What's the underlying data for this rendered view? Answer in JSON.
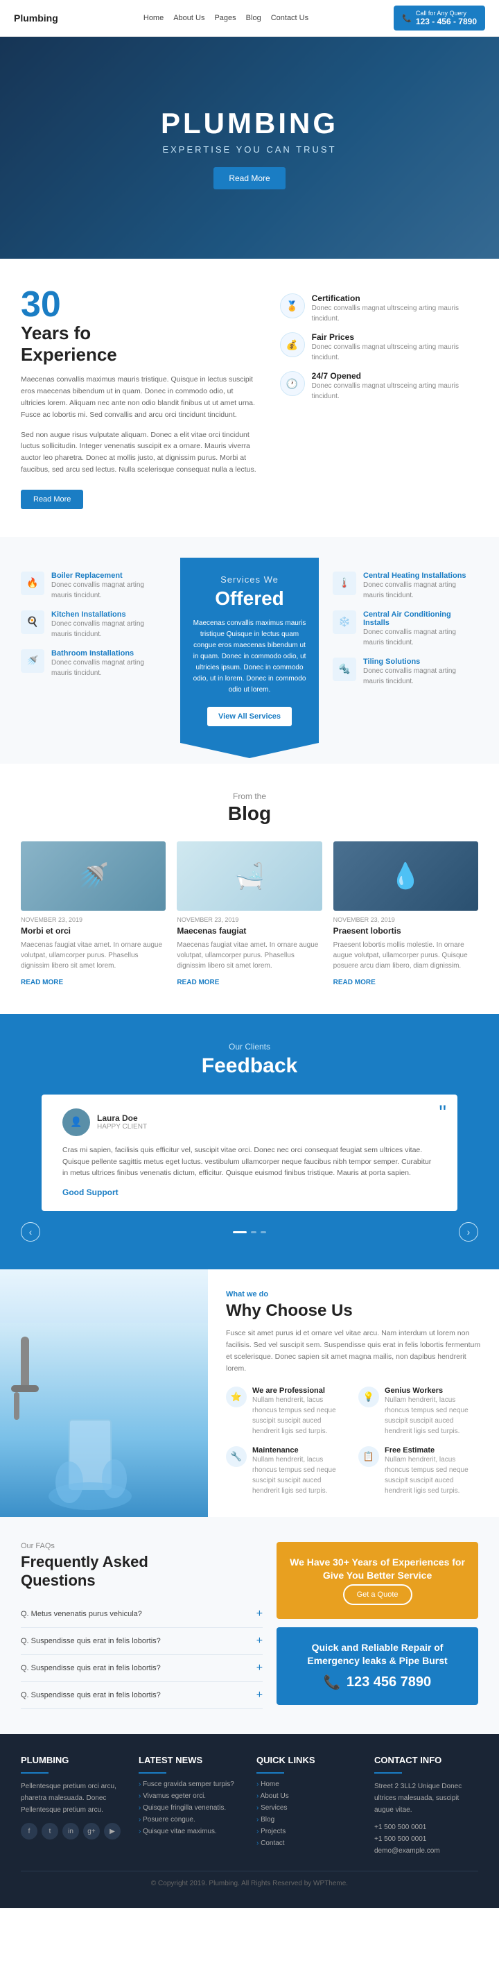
{
  "nav": {
    "logo": "Plumbing",
    "links": [
      "Home",
      "About Us",
      "Pages",
      "Blog",
      "Contact Us"
    ],
    "cta_label": "Call for Any Query",
    "phone": "123 - 456 - 7890"
  },
  "hero": {
    "title": "PLUMBING",
    "subtitle": "EXPERTISE YOU CAN TRUST",
    "btn": "Read More"
  },
  "experience": {
    "number": "30",
    "label_line1": "Years fo",
    "label_line2": "Experience",
    "text1": "Maecenas convallis maximus mauris tristique. Quisque in lectus suscipit eros maecenas bibendum ut in quam. Donec in commodo odio, ut ultricies lorem. Aliquam nec ante non odio blandit finibus ut ut amet urna. Fusce ac lobortis mi. Sed convallis and arcu orci tincidunt tincidunt.",
    "text2": "Sed non augue risus vulputate aliquam. Donec a elit vitae orci tincidunt luctus sollicitudin. Integer venenatis suscipit ex a ornare. Mauris viverra auctor leo pharetra. Donec at mollis justo, at dignissim purus. Morbi at faucibus, sed arcu sed lectus. Nulla scelerisque consequat nulla a lectus.",
    "btn": "Read More",
    "features": [
      {
        "icon": "🏅",
        "title": "Certification",
        "text": "Donec convallis magnat ultrsceing arting mauris tincidunt."
      },
      {
        "icon": "💰",
        "title": "Fair Prices",
        "text": "Donec convallis magnat ultrsceing arting mauris tincidunt."
      },
      {
        "icon": "🕐",
        "title": "24/7 Opened",
        "text": "Donec convallis magnat ultrsceing arting mauris tincidunt."
      }
    ]
  },
  "services": {
    "sub": "Services We",
    "title": "Offered",
    "desc": "Maecenas convallis maximus mauris tristique Quisque in lectus quam congue eros maecenas bibendum ut in quam. Donec in commodo odio, ut ultricies ipsum. Donec in commodo odio, ut in lorem. Donec in commodo odio ut lorem.",
    "btn": "View All Services",
    "left_items": [
      {
        "icon": "🔧",
        "title": "Boiler Replacement",
        "text": "Donec convallis magnat arting mauris tincidunt."
      },
      {
        "icon": "🍳",
        "title": "Kitchen Installations",
        "text": "Donec convallis magnat arting mauris tincidunt."
      },
      {
        "icon": "🚿",
        "title": "Bathroom Installations",
        "text": "Donec convallis magnat arting mauris tincidunt."
      }
    ],
    "right_items": [
      {
        "icon": "🌡️",
        "title": "Central Heating Installations",
        "text": "Donec convallis magnat arting mauris tincidunt."
      },
      {
        "icon": "❄️",
        "title": "Central Air Conditioning Installs",
        "text": "Donec convallis magnat arting mauris tincidunt."
      },
      {
        "icon": "🔩",
        "title": "Tiling Solutions",
        "text": "Donec convallis magnat arting mauris tincidunt."
      }
    ]
  },
  "blog": {
    "sub": "From the",
    "title": "Blog",
    "posts": [
      {
        "date": "NOVEMBER 23, 2019",
        "title": "Morbi et orci",
        "text": "Maecenas faugiat vitae amet. In ornare augue volutpat, ullamcorper purus. Phasellus dignissim libero sit amet lorem.",
        "read": "READ MORE",
        "img_type": "faucet"
      },
      {
        "date": "NOVEMBER 23, 2019",
        "title": "Maecenas faugiat",
        "text": "Maecenas faugiat vitae amet. In ornare augue volutpat, ullamcorper purus. Phasellus dignissim libero sit amet lorem.",
        "read": "READ MORE",
        "img_type": "bath"
      },
      {
        "date": "NOVEMBER 23, 2019",
        "title": "Praesent lobortis",
        "text": "Praesent lobortis mollis molestie. In ornare augue volutpat, ullamcorper purus. Quisque posuere arcu diam libero, diam dignissim.",
        "read": "READ MORE",
        "img_type": "shower"
      }
    ]
  },
  "feedback": {
    "sub": "Our Clients",
    "title": "Feedback",
    "testimonials": [
      {
        "name": "Laura Doe",
        "role": "HAPPY CLIENT",
        "text": "Cras mi sapien, facilisis quis efficitur vel, suscipit vitae orci. Donec nec orci consequat feugiat sem ultrices vitae. Quisque pellente sagittis metus eget luctus. vestibulum ullamcorper neque faucibus nibh tempor semper. Curabitur in metus ultrices finibus venenatis dictum, efficitur. Quisque euismod finibus tristique. Mauris at porta sapien.",
        "rating": "Good Support"
      }
    ]
  },
  "why": {
    "sub": "What we do",
    "title": "Why Choose Us",
    "desc": "Fusce sit amet purus id et ornare vel vitae arcu. Nam interdum ut lorem non facilisis. Sed vel suscipit sem. Suspendisse quis erat in felis lobortis fermentum et scelerisque. Donec sapien sit amet magna mailis, non dapibus hendrerit lorem.",
    "features": [
      {
        "icon": "⭐",
        "title": "We are Professional",
        "text": "Nullam hendrerit, lacus rhoncus tempus sed neque suscipit suscipit auced hendrerit ligis sed turpis."
      },
      {
        "icon": "💡",
        "title": "Genius Workers",
        "text": "Nullam hendrerit, lacus rhoncus tempus sed neque suscipit suscipit auced hendrerit ligis sed turpis."
      },
      {
        "icon": "🔧",
        "title": "Maintenance",
        "text": "Nullam hendrerit, lacus rhoncus tempus sed neque suscipit suscipit auced hendrerit ligis sed turpis."
      },
      {
        "icon": "📋",
        "title": "Free Estimate",
        "text": "Nullam hendrerit, lacus rhoncus tempus sed neque suscipit suscipit auced hendrerit ligis sed turpis."
      }
    ]
  },
  "faq": {
    "sub": "Our FAQs",
    "title_line1": "Frequently Asked",
    "title_line2": "Questions",
    "items": [
      "Q. Metus venenatis purus vehicula?",
      "Q. Suspendisse quis erat in felis lobortis?",
      "Q. Suspendisse quis erat in felis lobortis?",
      "Q. Suspendisse quis erat in felis lobortis?"
    ]
  },
  "cta_gold": {
    "title": "We Have 30+ Years of Experiences for Give You Better Service",
    "btn": "Get a Quote"
  },
  "cta_blue": {
    "title": "Quick and Reliable Repair of Emergency leaks & Pipe Burst",
    "phone": "123 456 7890"
  },
  "footer": {
    "cols": [
      {
        "title": "PLUMBING",
        "text": "Pellentesque pretium orci arcu, pharetra malesuada. Donec Pellentesque pretium arcu.",
        "social": [
          "f",
          "t",
          "in",
          "g+",
          "yt"
        ]
      },
      {
        "title": "LATEST NEWS",
        "items": [
          "Fusce gravida semper turpis?",
          "Vivamus egeter orci.",
          "Quisque fringilla venenatis.",
          "Posuere congue.",
          "Quisque vitae maximus."
        ]
      },
      {
        "title": "QUICK LINKS",
        "items": [
          "Home",
          "About Us",
          "Services",
          "Blog",
          "Projects",
          "Contact"
        ]
      },
      {
        "title": "CONTACT INFO",
        "address": "Street 2 3LL2 Unique\nDonec ultrices malesuada, suscipit augue vitae.",
        "phone1": "+1 500 500 0001",
        "phone2": "+1 500 500 0001",
        "email": "demo@example.com"
      }
    ],
    "copyright": "© Copyright 2019. Plumbing. All Rights Reserved by WPTheme."
  }
}
